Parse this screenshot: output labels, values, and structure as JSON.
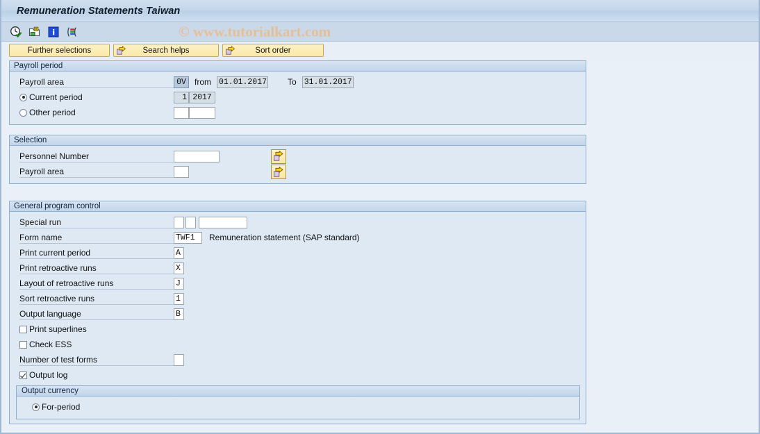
{
  "window": {
    "title": "Remuneration Statements Taiwan"
  },
  "watermark": "© www.tutorialkart.com",
  "toolbar": {
    "icons": [
      {
        "name": "execute-clock-icon"
      },
      {
        "name": "execute-background-icon"
      },
      {
        "name": "info-icon"
      },
      {
        "name": "variant-bars-icon"
      }
    ]
  },
  "buttons": [
    {
      "label": "Further selections",
      "icon": null
    },
    {
      "label": "Search helps",
      "icon": "arrow-right-icon"
    },
    {
      "label": "Sort order",
      "icon": "arrow-right-icon"
    }
  ],
  "payroll_period": {
    "title": "Payroll period",
    "payroll_area": {
      "label": "Payroll area",
      "value": "0V",
      "from_label": "from",
      "from_value": "01.01.2017",
      "to_label": "To",
      "to_value": "31.01.2017"
    },
    "current_period": {
      "label": "Current period",
      "selected": true,
      "period": "1",
      "year": "2017"
    },
    "other_period": {
      "label": "Other period",
      "selected": false,
      "period": "",
      "year": ""
    }
  },
  "selection": {
    "title": "Selection",
    "rows": [
      {
        "label": "Personnel Number",
        "value": "",
        "has_multi_button": true
      },
      {
        "label": "Payroll area",
        "value": "",
        "has_multi_button": true
      }
    ]
  },
  "general_program_control": {
    "title": "General program control",
    "special_run": {
      "label": "Special run",
      "value_1": "",
      "value_2": "",
      "value_3": ""
    },
    "form_name": {
      "label": "Form name",
      "value": "TWF1",
      "description": "Remuneration statement (SAP standard)"
    },
    "fields": [
      {
        "label": "Print current period",
        "value": "A"
      },
      {
        "label": "Print retroactive runs",
        "value": "X"
      },
      {
        "label": "Layout of retroactive runs",
        "value": "J"
      },
      {
        "label": "Sort retroactive runs",
        "value": "1"
      },
      {
        "label": "Output language",
        "value": "B"
      }
    ],
    "checkboxes": [
      {
        "label": "Print superlines",
        "checked": false
      },
      {
        "label": "Check ESS",
        "checked": false
      }
    ],
    "number_of_test_forms": {
      "label": "Number of test forms",
      "value": ""
    },
    "output_log": {
      "label": "Output log",
      "checked": true
    },
    "output_currency": {
      "title": "Output currency",
      "options": [
        {
          "label": "For-period",
          "selected": true
        }
      ]
    }
  }
}
